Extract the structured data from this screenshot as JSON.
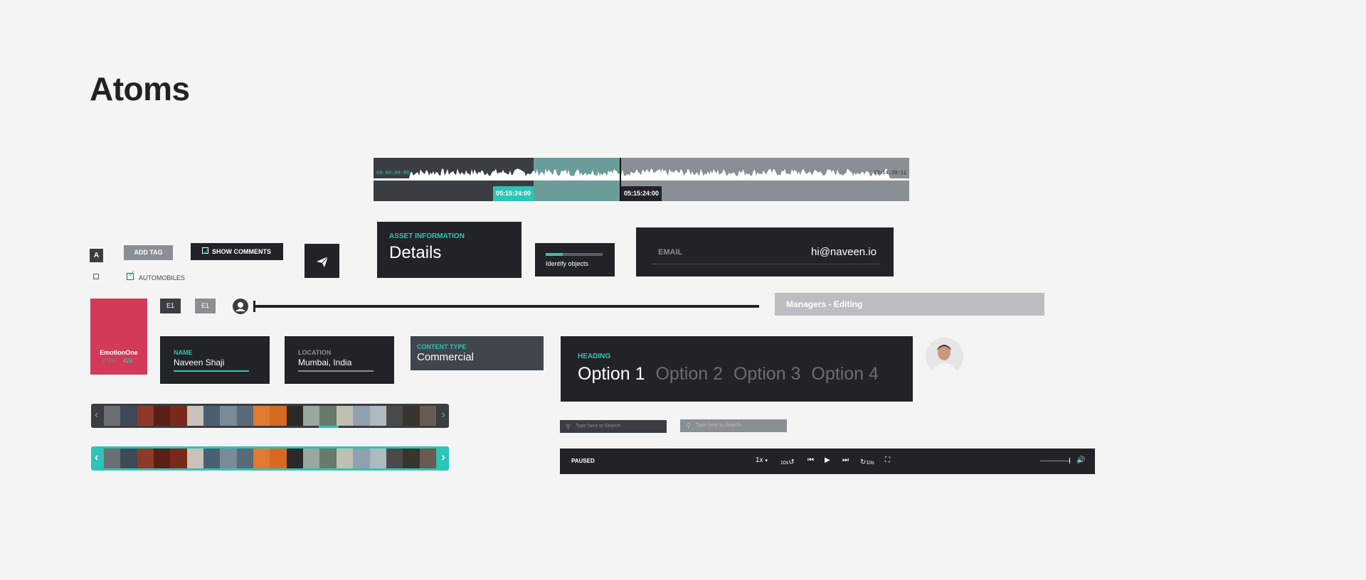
{
  "page": {
    "title": "Atoms"
  },
  "timeline": {
    "start_time": "00:00:00:00",
    "end_time": "23:14:20:11",
    "in_time": "05:15:24:00",
    "out_time": "05:15:24:00",
    "colors": {
      "base": "#3a3d42",
      "selected": "#2a8a85",
      "rest": "#8a8e95",
      "accent": "#2ec4b6"
    }
  },
  "tags": {
    "letter_tag": "A",
    "add_tag_label": "ADD TAG",
    "show_comments_label": "SHOW COMMENTS",
    "automobiles_label": "AUTOMOBILES",
    "send_icon": "paper-plane-icon"
  },
  "asset_info": {
    "label": "ASSET INFORMATION",
    "value": "Details"
  },
  "identify": {
    "label": "Identify objects",
    "progress": 0.3
  },
  "email": {
    "label": "EMAIL",
    "value": "hi@naveen.io"
  },
  "emotion": {
    "name": "EmotionOne",
    "percent": "2.5%",
    "duration": "42s",
    "color": "#d23a57"
  },
  "episode_tags": {
    "dark": "E1",
    "light": "E1"
  },
  "managers": {
    "label": "Managers - Editing"
  },
  "fields": {
    "name": {
      "label": "NAME",
      "value": "Naveen Shaji"
    },
    "location": {
      "label": "LOCATION",
      "value": "Mumbai, India"
    },
    "content_type": {
      "label": "CONTENT TYPE",
      "value": "Commercial"
    }
  },
  "options": {
    "heading": "HEADING",
    "items": [
      "Option 1",
      "Option 2",
      "Option 3",
      "Option 4"
    ],
    "selected": 0
  },
  "search": {
    "dark_placeholder": "Type here to Search",
    "light_placeholder": "Type here to Search"
  },
  "player": {
    "state": "PAUSED",
    "speed": "1x",
    "skip_back": "10s",
    "skip_forward": "10s",
    "volume": 1.0
  },
  "filmstrip": {
    "frame_colors": [
      "#6b6e72",
      "#3e4a55",
      "#8c3a2a",
      "#5a2018",
      "#7a2a1a",
      "#c9c2b8",
      "#4a6070",
      "#7a8a96",
      "#5b6a78",
      "#e07a30",
      "#d86a20",
      "#2a2a2a",
      "#9aa7a0",
      "#6a7a6a",
      "#c0c0b0",
      "#8fa0b0",
      "#b0b8c0",
      "#4a4a4a",
      "#3a3430",
      "#6a5a50"
    ]
  }
}
